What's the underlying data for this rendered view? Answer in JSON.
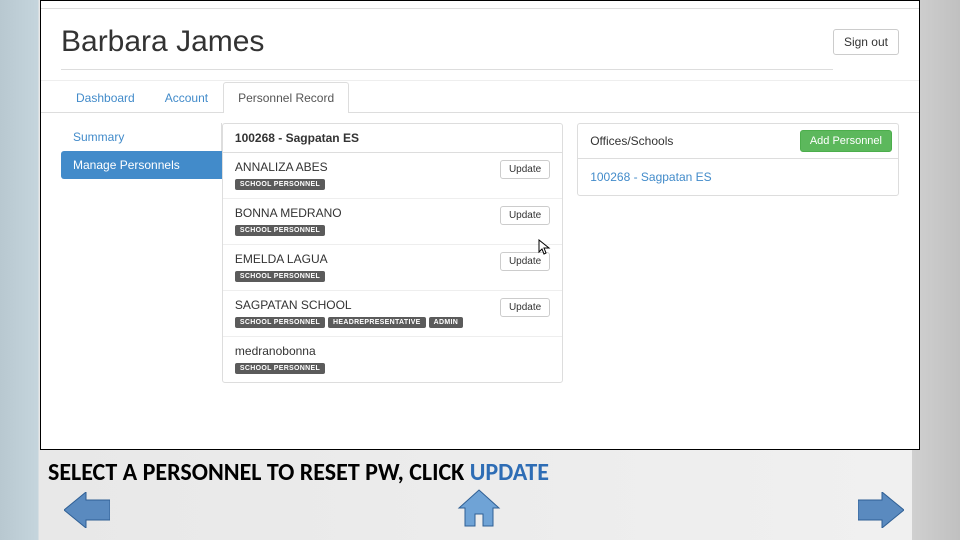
{
  "header": {
    "user_name": "Barbara James",
    "signout_label": "Sign out"
  },
  "tabs": {
    "dashboard": "Dashboard",
    "account": "Account",
    "personnel_record": "Personnel Record"
  },
  "subtabs": {
    "summary": "Summary",
    "manage_personnels": "Manage Personnels"
  },
  "school_panel": {
    "title": "100268 - Sagpatan ES"
  },
  "personnel": [
    {
      "name": "ANNALIZA ABES",
      "badges": [
        "SCHOOL PERSONNEL"
      ],
      "update": "Update"
    },
    {
      "name": "BONNA MEDRANO",
      "badges": [
        "SCHOOL PERSONNEL"
      ],
      "update": "Update"
    },
    {
      "name": "EMELDA LAGUA",
      "badges": [
        "SCHOOL PERSONNEL"
      ],
      "update": "Update"
    },
    {
      "name": "SAGPATAN SCHOOL",
      "badges": [
        "SCHOOL PERSONNEL",
        "HEADREPRESENTATIVE",
        "ADMIN"
      ],
      "update": "Update"
    },
    {
      "name": "medranobonna",
      "badges": [
        "SCHOOL PERSONNEL"
      ],
      "update": ""
    }
  ],
  "right": {
    "title": "Offices/Schools",
    "add_label": "Add Personnel",
    "school_link": "100268 - Sagpatan ES"
  },
  "instruction": {
    "prefix": "SELECT A PERSONNEL TO RESET PW, CLICK ",
    "keyword": "UPDATE"
  },
  "colors": {
    "primary": "#428bca",
    "success": "#5cb85c"
  }
}
